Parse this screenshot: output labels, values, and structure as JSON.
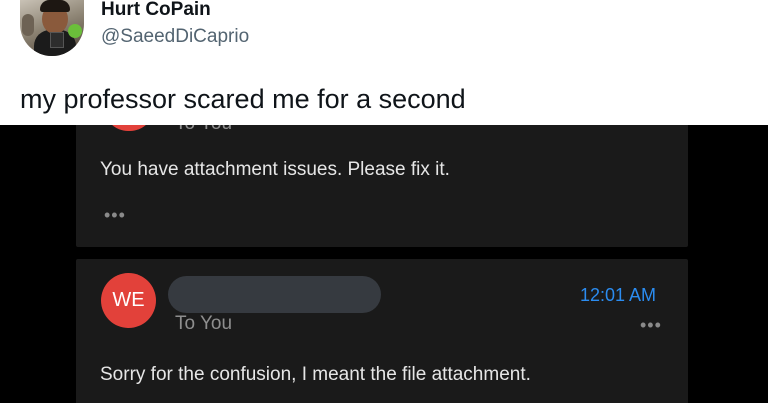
{
  "tweet": {
    "display_name": "Hurt CoPain",
    "handle": "@SaeedDiCaprio",
    "text": "my professor scared me for a second",
    "avatar_icon": "profile-photo"
  },
  "email_screenshot": {
    "message_1": {
      "recipient": "To You",
      "body": "You have attachment issues. Please fix it.",
      "more_indicator": "•••"
    },
    "message_2": {
      "sender_initials": "WE",
      "recipient": "To You",
      "time": "12:01 AM",
      "more_indicator": "•••",
      "body": "Sorry for the confusion, I meant the file attachment."
    },
    "colors": {
      "background": "#000000",
      "card": "#1a1a1a",
      "avatar": "#e2413a",
      "time": "#2b8cf0",
      "redaction": "#363a40"
    }
  }
}
